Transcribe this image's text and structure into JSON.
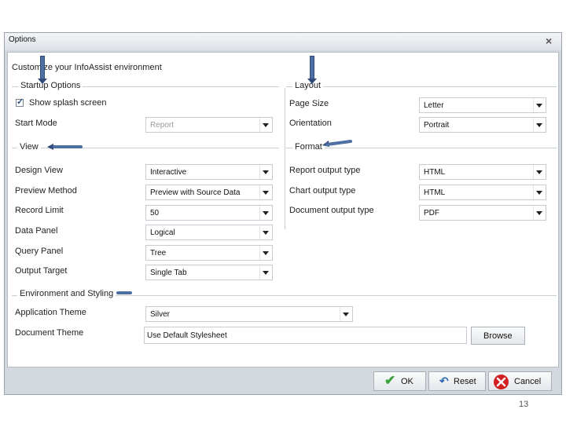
{
  "dialog": {
    "title": "Options",
    "subtitle": "Customize your InfoAssist environment",
    "close_glyph": "×"
  },
  "startup": {
    "title": "Startup Options",
    "splash_label": "Show splash screen",
    "splash_checked": true,
    "start_mode_label": "Start Mode",
    "start_mode_value": "Report"
  },
  "layout": {
    "title": "Layout",
    "page_size_label": "Page Size",
    "page_size_value": "Letter",
    "orientation_label": "Orientation",
    "orientation_value": "Portrait"
  },
  "view": {
    "title": "View",
    "design_view_label": "Design View",
    "design_view_value": "Interactive",
    "preview_method_label": "Preview Method",
    "preview_method_value": "Preview with Source Data",
    "record_limit_label": "Record Limit",
    "record_limit_value": "50",
    "data_panel_label": "Data Panel",
    "data_panel_value": "Logical",
    "query_panel_label": "Query Panel",
    "query_panel_value": "Tree",
    "output_target_label": "Output Target",
    "output_target_value": "Single Tab"
  },
  "format": {
    "title": "Format",
    "report_output_label": "Report output type",
    "report_output_value": "HTML",
    "chart_output_label": "Chart output type",
    "chart_output_value": "HTML",
    "document_output_label": "Document output type",
    "document_output_value": "PDF"
  },
  "environment": {
    "title": "Environment and Styling",
    "app_theme_label": "Application Theme",
    "app_theme_value": "Silver",
    "doc_theme_label": "Document Theme",
    "doc_theme_value": "Use Default Stylesheet",
    "browse_label": "Browse"
  },
  "footer": {
    "ok_label": "OK",
    "reset_label": "Reset",
    "cancel_label": "Cancel"
  },
  "slide": {
    "page_number": "13"
  },
  "colors": {
    "dialog_bg": "#d3d8de",
    "arrow_blue": "#4d6fa1",
    "ok_green": "#3aa33a",
    "cancel_red": "#d02020"
  },
  "icons": [
    "close-icon",
    "checkbox-icon",
    "ok-check-icon",
    "reset-icon",
    "cancel-icon",
    "dropdown-arrow-icon",
    "annotation-arrow-icon"
  ]
}
